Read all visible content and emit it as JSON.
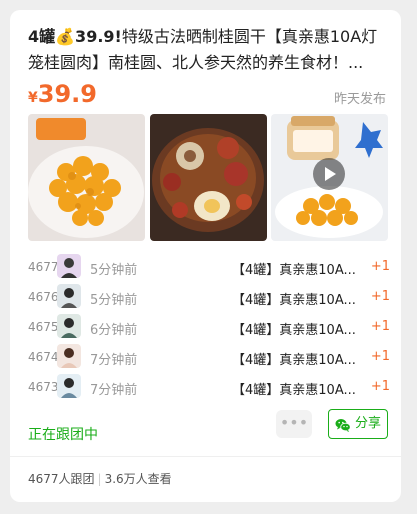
{
  "card": {
    "title_bold": "4罐💰39.9!",
    "title_rest": "特级古法晒制桂圆干【真亲惠10A灯笼桂圆肉】南桂圆、北人参天然的养生食材！...",
    "currency": "¥",
    "price": "39.9",
    "posted": "昨天发布"
  },
  "images": [
    {
      "name": "dried-longan-plate-photo"
    },
    {
      "name": "longan-soup-bowl-photo"
    },
    {
      "name": "longan-jar-video"
    }
  ],
  "buyers": [
    {
      "seq": "4677",
      "ago": "5分钟前",
      "product": "【4罐】真亲惠10A...",
      "qty": "+1"
    },
    {
      "seq": "4676",
      "ago": "5分钟前",
      "product": "【4罐】真亲惠10A...",
      "qty": "+1"
    },
    {
      "seq": "4675",
      "ago": "6分钟前",
      "product": "【4罐】真亲惠10A...",
      "qty": "+1"
    },
    {
      "seq": "4674",
      "ago": "7分钟前",
      "product": "【4罐】真亲惠10A...",
      "qty": "+1"
    },
    {
      "seq": "4673",
      "ago": "7分钟前",
      "product": "【4罐】真亲惠10A...",
      "qty": "+1"
    }
  ],
  "footer": {
    "follow": "正在跟团中",
    "more": "•••",
    "share": "分享",
    "joined": "4677人跟团",
    "views": "3.6万人查看"
  },
  "colors": {
    "accent_orange": "#f2692b",
    "accent_green": "#1aad19"
  }
}
